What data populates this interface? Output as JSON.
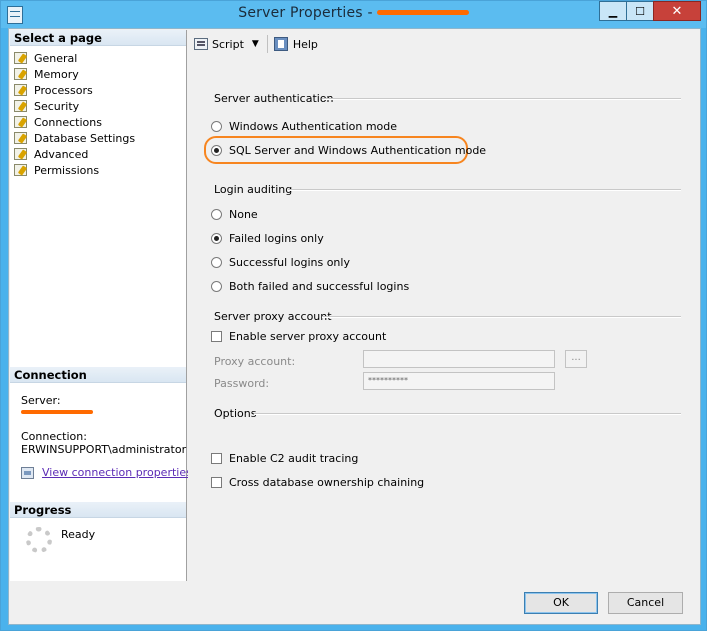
{
  "window": {
    "title": "Server Properties -",
    "controls": {
      "minimize": "▁",
      "maximize": "☐",
      "close": "✕"
    }
  },
  "left_pane": {
    "select_page_header": "Select a page",
    "pages": [
      {
        "label": "General",
        "icon": "page-icon"
      },
      {
        "label": "Memory",
        "icon": "page-icon"
      },
      {
        "label": "Processors",
        "icon": "page-icon"
      },
      {
        "label": "Security",
        "icon": "page-icon"
      },
      {
        "label": "Connections",
        "icon": "page-icon"
      },
      {
        "label": "Database Settings",
        "icon": "page-icon"
      },
      {
        "label": "Advanced",
        "icon": "page-icon"
      },
      {
        "label": "Permissions",
        "icon": "page-icon"
      }
    ],
    "connection_header": "Connection",
    "server_label": "Server:",
    "connection_label": "Connection:",
    "connection_value": "ERWINSUPPORT\\administrator",
    "view_connection_link": "View connection properties",
    "progress_header": "Progress",
    "progress_status": "Ready"
  },
  "toolbar": {
    "script_label": "Script",
    "help_label": "Help"
  },
  "server_authentication": {
    "heading": "Server authentication",
    "options": [
      {
        "label": "Windows Authentication mode",
        "selected": false
      },
      {
        "label": "SQL Server and Windows Authentication mode",
        "selected": true
      }
    ]
  },
  "login_auditing": {
    "heading": "Login auditing",
    "options": [
      {
        "label": "None",
        "selected": false
      },
      {
        "label": "Failed logins only",
        "selected": true
      },
      {
        "label": "Successful logins only",
        "selected": false
      },
      {
        "label": "Both failed and successful logins",
        "selected": false
      }
    ]
  },
  "server_proxy": {
    "heading": "Server proxy account",
    "enable_label": "Enable server proxy account",
    "enabled": false,
    "proxy_account_label": "Proxy account:",
    "proxy_account_value": "",
    "browse_label": "...",
    "password_label": "Password:",
    "password_value": "**********"
  },
  "options": {
    "heading": "Options",
    "c2_audit_label": "Enable C2 audit tracing",
    "c2_audit_checked": false,
    "cross_db_label": "Cross database ownership chaining",
    "cross_db_checked": false
  },
  "buttons": {
    "ok": "OK",
    "cancel": "Cancel"
  },
  "colors": {
    "title_bar": "#5bbcf0",
    "highlight_annotation": "#f7851f",
    "redaction": "#ff6a00",
    "link": "#5b2bb5"
  }
}
